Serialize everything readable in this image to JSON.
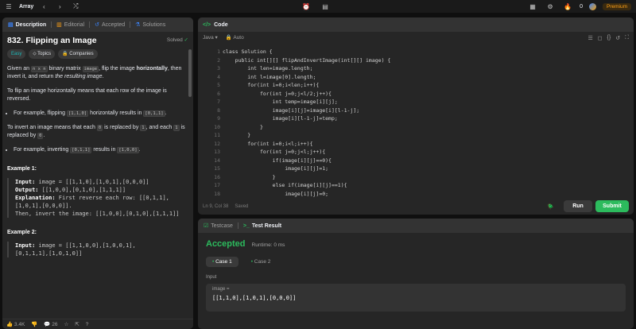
{
  "topbar": {
    "nav_label": "Array",
    "premium": "Premium",
    "streak": "0"
  },
  "tabs": {
    "description": "Description",
    "editorial": "Editorial",
    "accepted": "Accepted",
    "solutions": "Solutions"
  },
  "problem": {
    "title": "832. Flipping an Image",
    "solved": "Solved",
    "chips": [
      "Easy",
      "Topics",
      "Companies"
    ],
    "p1a": "Given an",
    "p1code": "n x n",
    "p1b": "binary matrix",
    "p1code2": "image",
    "p1c": ", flip the image",
    "p1d": "horizontally",
    "p1e": ", then invert it, and return",
    "p1f": "the resulting image",
    "p2": "To flip an image horizontally means that each row of the image is reversed.",
    "b1a": "For example, flipping",
    "b1code": "[1,1,0]",
    "b1b": "horizontally results in",
    "b1code2": "[0,1,1]",
    "p3a": "To invert an image means that each",
    "p3code": "0",
    "p3b": "is replaced by",
    "p3code2": "1",
    "p3c": ", and each",
    "p3code3": "1",
    "p3d": "is replaced by",
    "p3code4": "0",
    "b2a": "For example, inverting",
    "b2code": "[0,1,1]",
    "b2b": "results in",
    "b2code2": "[1,0,0]",
    "ex1": "Example 1:",
    "ex1_input_lbl": "Input:",
    "ex1_input": "image = [[1,1,0],[1,0,1],[0,0,0]]",
    "ex1_output_lbl": "Output:",
    "ex1_output": "[[1,0,0],[0,1,0],[1,1,1]]",
    "ex1_expl_lbl": "Explanation:",
    "ex1_expl": "First reverse each row: [[0,1,1],[1,0,1],[0,0,0]].",
    "ex1_expl2": "Then, invert the image: [[1,0,0],[0,1,0],[1,1,1]]",
    "ex2": "Example 2:",
    "ex2_input_lbl": "Input:",
    "ex2_input": "image = [[1,1,0,0],[1,0,0,1],",
    "ex2_input2": "[0,1,1,1],[1,0,1,0]]",
    "likes": "3.4K",
    "comments": "26"
  },
  "code": {
    "header": "Code",
    "lang": "Java",
    "mode": "Auto",
    "status": "Ln 9, Col 38",
    "saved": "Saved",
    "run": "Run",
    "submit": "Submit",
    "lines": [
      "class Solution {",
      "    public int[][] flipAndInvertImage(int[][] image) {",
      "        int len=image.length;",
      "        int l=image[0].length;",
      "        for(int i=0;i<len;i++){",
      "            for(int j=0;j<l/2;j++){",
      "                int temp=image[i][j];",
      "                image[i][j]=image[i][l-1-j];",
      "                image[i][l-1-j]=temp;",
      "            }",
      "        }",
      "        for(int i=0;i<l;i++){",
      "            for(int j=0;j<l;j++){",
      "                if(image[i][j]==0){",
      "                    image[i][j]=1;",
      "                }",
      "                else if(image[i][j]==1){",
      "                    image[i][j]=0;"
    ]
  },
  "result": {
    "testcase": "Testcase",
    "testresult": "Test Result",
    "status": "Accepted",
    "runtime": "Runtime: 0 ms",
    "case1": "Case 1",
    "case2": "Case 2",
    "input_label": "Input",
    "var": "image =",
    "value": "[[1,1,0],[1,0,1],[0,0,0]]"
  }
}
